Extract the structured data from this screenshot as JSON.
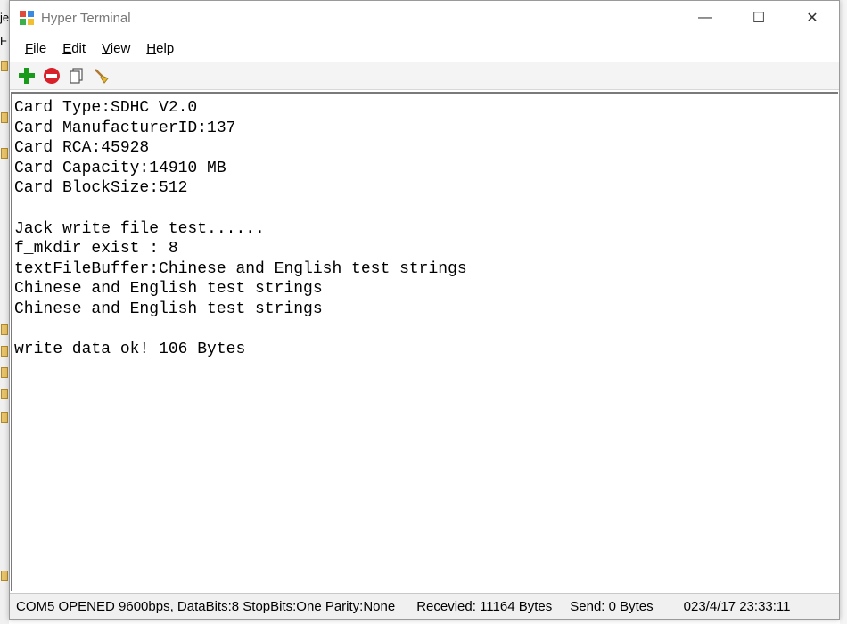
{
  "window": {
    "title": "Hyper Terminal",
    "controls": {
      "minimize": "—",
      "maximize": "☐",
      "close": "✕"
    }
  },
  "menu": [
    {
      "label": "File",
      "mnemonic": "F",
      "rest": "ile"
    },
    {
      "label": "Edit",
      "mnemonic": "E",
      "rest": "dit"
    },
    {
      "label": "View",
      "mnemonic": "V",
      "rest": "iew"
    },
    {
      "label": "Help",
      "mnemonic": "H",
      "rest": "elp"
    }
  ],
  "toolbar": {
    "icons": [
      "connect-plus-icon",
      "disconnect-stop-icon",
      "copy-icon",
      "clear-broom-icon"
    ],
    "colors": {
      "plus": "#1a9a1a",
      "stop": "#d8202a"
    }
  },
  "terminal": {
    "lines": [
      "Card Type:SDHC V2.0",
      "Card ManufacturerID:137",
      "Card RCA:45928",
      "Card Capacity:14910 MB",
      "Card BlockSize:512",
      "",
      "Jack write file test......",
      "f_mkdir exist : 8",
      "textFileBuffer:Chinese and English test strings",
      "Chinese and English test strings",
      "Chinese and English test strings",
      "",
      "write data ok! 106 Bytes"
    ]
  },
  "status": {
    "connection": "COM5 OPENED 9600bps, DataBits:8 StopBits:One Parity:None",
    "received": "Recevied: 11164 Bytes",
    "sent": "Send: 0 Bytes",
    "datetime": "023/4/17 23:33:11"
  },
  "background": {
    "left_fragments": [
      "je",
      "F"
    ]
  }
}
